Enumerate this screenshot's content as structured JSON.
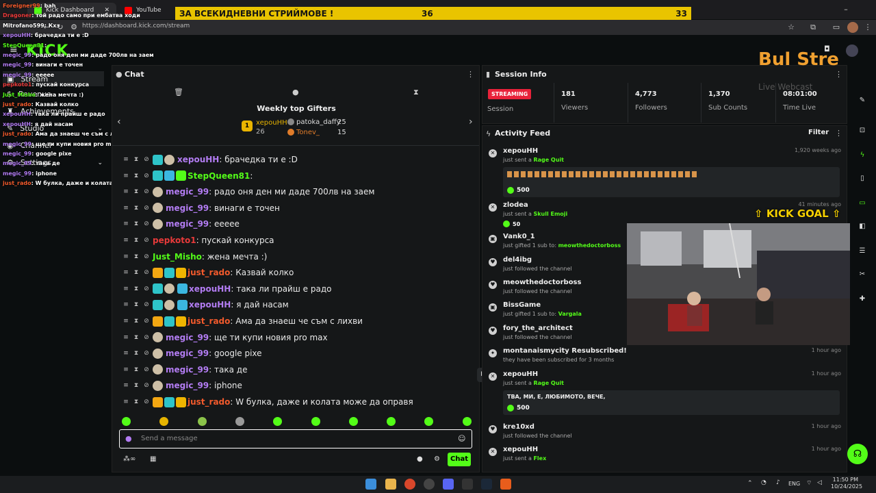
{
  "browser": {
    "tabs": [
      {
        "label": "Kick Dashboard"
      },
      {
        "label": "YouTube"
      }
    ],
    "url": "https://dashboard.kick.com/stream",
    "banner": {
      "title": "ЗА ВСЕКИДНЕВНИ СТРИЙМОВЕ !",
      "num1": "36",
      "num2": "33"
    }
  },
  "app": {
    "logo": "KICK"
  },
  "sidebar": {
    "items": [
      {
        "label": "Stream"
      },
      {
        "label": "Revenue"
      },
      {
        "label": "Achievements"
      },
      {
        "label": "Studio"
      },
      {
        "label": "Channel"
      },
      {
        "label": "Settings"
      }
    ]
  },
  "overlay_chat": [
    {
      "user": "Foreigner99",
      "text": ": bah"
    },
    {
      "user": "Dragoner",
      "text": ": той радо само при ембатва ходи"
    },
    {
      "user": "Mitrofano599",
      "text": ": Кхз"
    },
    {
      "user": "xepouHH",
      "text": ": брачедка ти е :D"
    },
    {
      "user": "StepQueen81",
      "text": ":"
    },
    {
      "user": "megic_99",
      "text": ": радо оня ден ми даде 700лв на заем"
    },
    {
      "user": "megic_99",
      "text": ": винаги е точен"
    },
    {
      "user": "megic_99",
      "text": ": eeeee"
    },
    {
      "user": "pepkoto1",
      "text": ": пускай конкурса"
    },
    {
      "user": "Just_Misho",
      "text": ": жена мечта :)"
    },
    {
      "user": "just_rado",
      "text": ": Казвай колко"
    },
    {
      "user": "xepouHH",
      "text": ": така ли прайш е радо"
    },
    {
      "user": "xepouHH",
      "text": ": я дай насам"
    },
    {
      "user": "just_rado",
      "text": ": Ама да знаеш че съм с лихви"
    },
    {
      "user": "megic_99",
      "text": ": ще ти купи новия pro max"
    },
    {
      "user": "megic_99",
      "text": ": google pixe"
    },
    {
      "user": "megic_99",
      "text": ": така де"
    },
    {
      "user": "megic_99",
      "text": ": iphone"
    },
    {
      "user": "just_rado",
      "text": ": W булка, даже и колата може да оправя"
    }
  ],
  "chat": {
    "title": "Chat",
    "gifters_title": "Weekly top Gifters",
    "gifters": [
      {
        "rank": "1",
        "name": "xepouHH",
        "count": "26"
      },
      {
        "name": "patoka_daffy",
        "count": "25"
      },
      {
        "name": "Tonev_",
        "count": "15"
      }
    ],
    "messages": [
      {
        "user": "xepouHH",
        "text": ": брачедка ти е :D",
        "color": "#b27cf2"
      },
      {
        "user": "StepQueen81",
        "text": ":",
        "color": "#53fc18"
      },
      {
        "user": "megic_99",
        "text": ": радо оня ден ми даде 700лв на заем",
        "color": "#b27cf2"
      },
      {
        "user": "megic_99",
        "text": ": винаги е точен",
        "color": "#b27cf2"
      },
      {
        "user": "megic_99",
        "text": ": eeeee",
        "color": "#b27cf2"
      },
      {
        "user": "pepkoto1",
        "text": ": пускай конкурса",
        "color": "#e83a3a"
      },
      {
        "user": "Just_Misho",
        "text": ": жена мечта :)",
        "color": "#53fc18"
      },
      {
        "user": "just_rado",
        "text": ": Казвай колко",
        "color": "#f25a2c"
      },
      {
        "user": "xepouHH",
        "text": ": така ли прайш е радо",
        "color": "#b27cf2"
      },
      {
        "user": "xepouHH",
        "text": ": я дай насам",
        "color": "#b27cf2"
      },
      {
        "user": "just_rado",
        "text": ": Ама да знаеш че съм с лихви",
        "color": "#f25a2c"
      },
      {
        "user": "megic_99",
        "text": ": ще ти купи новия pro max",
        "color": "#b27cf2"
      },
      {
        "user": "megic_99",
        "text": ": google pixe",
        "color": "#b27cf2"
      },
      {
        "user": "megic_99",
        "text": ": така де",
        "color": "#b27cf2"
      },
      {
        "user": "megic_99",
        "text": ": iphone",
        "color": "#b27cf2"
      },
      {
        "user": "just_rado",
        "text": ": W булка, даже и колата може да оправя",
        "color": "#f25a2c"
      }
    ],
    "input_placeholder": "Send a message",
    "send_label": "Chat"
  },
  "session": {
    "title": "Session Info",
    "status": "STREAMING",
    "status_label": "Session",
    "stats": [
      {
        "value": "181",
        "label": "Viewers"
      },
      {
        "value": "4,773",
        "label": "Followers"
      },
      {
        "value": "1,370",
        "label": "Sub Counts"
      },
      {
        "value": "08:01:00",
        "label": "Time Live"
      }
    ]
  },
  "activity": {
    "title": "Activity Feed",
    "filter_label": "Filter",
    "items": [
      {
        "name": "xepouHH",
        "pre": "just sent a",
        "hl": "Rage Quit",
        "time": "1,920 weeks ago",
        "kicks": "500"
      },
      {
        "name": "zlodea",
        "pre": "just sent a",
        "hl": "Skull Emoji",
        "time": "41 minutes ago",
        "kicks": "50"
      },
      {
        "name": "Vank0_1",
        "pre": "just gifted 1 sub to:",
        "hl": "meowthedoctorboss",
        "time": ""
      },
      {
        "name": "del4ibg",
        "pre": "just followed the channel",
        "hl": "",
        "time": ""
      },
      {
        "name": "meowthedoctorboss",
        "pre": "just followed the channel",
        "hl": "",
        "time": ""
      },
      {
        "name": "BissGame",
        "pre": "just gifted 1 sub to:",
        "hl": "Vargala",
        "time": ""
      },
      {
        "name": "fory_the_architect",
        "pre": "just followed the channel",
        "hl": "",
        "time": ""
      },
      {
        "name": "montanaismycity Resubscribed!",
        "pre": "they have been subscribed for 3 months",
        "hl": "",
        "time": "1 hour ago"
      },
      {
        "name": "xepouHH",
        "pre": "just sent a",
        "hl": "Rage Quit",
        "time": "1 hour ago",
        "message": "ТВА, МИ, Е, ЛЮБИМОТО, ВЕЧЕ,",
        "kicks": "500"
      },
      {
        "name": "kre10xd",
        "pre": "just followed the channel",
        "hl": "",
        "time": "1 hour ago"
      },
      {
        "name": "xepouHH",
        "pre": "just sent a",
        "hl": "Flex",
        "time": "1 hour ago"
      }
    ]
  },
  "overlay": {
    "kick_goal": "KICK GOAL",
    "brand": "Bul Stre",
    "brand_sub": "Live Webcast"
  },
  "taskbar": {
    "lang": "ENG",
    "time": "11:50 PM",
    "date": "10/24/2025"
  }
}
